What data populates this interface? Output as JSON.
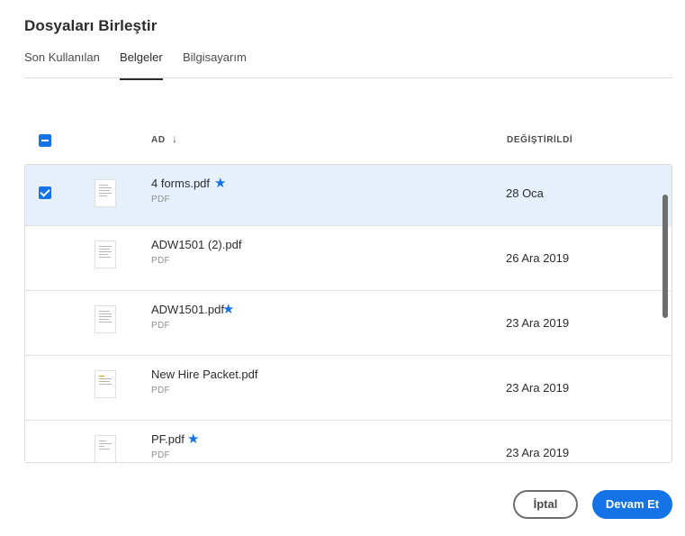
{
  "dialog": {
    "title": "Dosyaları Birleştir"
  },
  "tabs": [
    {
      "label": "Son Kullanılan",
      "active": false
    },
    {
      "label": "Belgeler",
      "active": true
    },
    {
      "label": "Bilgisayarım",
      "active": false
    }
  ],
  "table": {
    "columns": {
      "name": "AD",
      "modified": "DEĞİŞTİRİLDİ"
    },
    "sort_icon": "arrow-down-icon",
    "select_all_state": "indeterminate",
    "rows": [
      {
        "name": "4 forms.pdf",
        "type": "PDF",
        "date": "28 Oca",
        "starred": true,
        "selected": true
      },
      {
        "name": "ADW1501 (2).pdf",
        "type": "PDF",
        "date": "26 Ara 2019",
        "starred": false,
        "selected": false
      },
      {
        "name": "ADW1501.pdf",
        "type": "PDF",
        "date": "23 Ara 2019",
        "starred": true,
        "selected": false
      },
      {
        "name": "New Hire Packet.pdf",
        "type": "PDF",
        "date": "23 Ara 2019",
        "starred": false,
        "selected": false
      },
      {
        "name": "PF.pdf",
        "type": "PDF",
        "date": "23 Ara 2019",
        "starred": true,
        "selected": false
      }
    ]
  },
  "buttons": {
    "cancel": "İptal",
    "continue": "Devam Et"
  },
  "colors": {
    "accent": "#1473e6",
    "selected_row": "#e5f0fb"
  }
}
